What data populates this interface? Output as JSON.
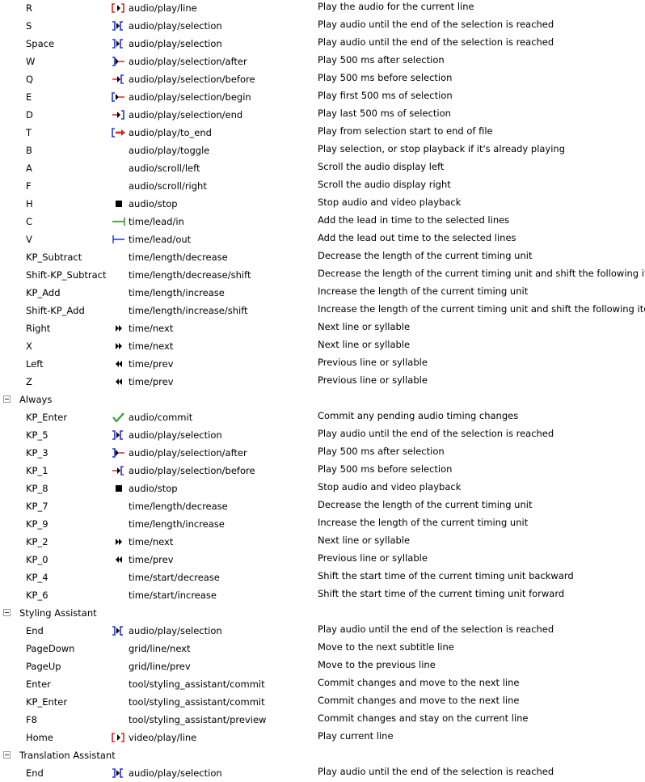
{
  "rows": [
    {
      "key": "R",
      "icon": "play-line",
      "command": "audio/play/line",
      "description": "Play the audio for the current line"
    },
    {
      "key": "S",
      "icon": "play-selection",
      "command": "audio/play/selection",
      "description": "Play audio until the end of the selection is reached"
    },
    {
      "key": "Space",
      "icon": "play-selection",
      "command": "audio/play/selection",
      "description": "Play audio until the end of the selection is reached"
    },
    {
      "key": "W",
      "icon": "play-after",
      "command": "audio/play/selection/after",
      "description": "Play 500 ms after selection"
    },
    {
      "key": "Q",
      "icon": "play-before",
      "command": "audio/play/selection/before",
      "description": "Play 500 ms before selection"
    },
    {
      "key": "E",
      "icon": "play-begin",
      "command": "audio/play/selection/begin",
      "description": "Play first 500 ms of selection"
    },
    {
      "key": "D",
      "icon": "play-end",
      "command": "audio/play/selection/end",
      "description": "Play last 500 ms of selection"
    },
    {
      "key": "T",
      "icon": "play-to-end",
      "command": "audio/play/to_end",
      "description": "Play from selection start to end of file"
    },
    {
      "key": "B",
      "icon": "",
      "command": "audio/play/toggle",
      "description": "Play selection, or stop playback if it's already playing"
    },
    {
      "key": "A",
      "icon": "",
      "command": "audio/scroll/left",
      "description": "Scroll the audio display left"
    },
    {
      "key": "F",
      "icon": "",
      "command": "audio/scroll/right",
      "description": "Scroll the audio display right"
    },
    {
      "key": "H",
      "icon": "stop",
      "command": "audio/stop",
      "description": "Stop audio and video playback"
    },
    {
      "key": "C",
      "icon": "lead-in",
      "command": "time/lead/in",
      "description": "Add the lead in time to the selected lines"
    },
    {
      "key": "V",
      "icon": "lead-out",
      "command": "time/lead/out",
      "description": "Add the lead out time to the selected lines"
    },
    {
      "key": "KP_Subtract",
      "icon": "",
      "command": "time/length/decrease",
      "description": "Decrease the length of the current timing unit"
    },
    {
      "key": "Shift-KP_Subtract",
      "icon": "",
      "command": "time/length/decrease/shift",
      "description": "Decrease the length of the current timing unit and shift the following items"
    },
    {
      "key": "KP_Add",
      "icon": "",
      "command": "time/length/increase",
      "description": "Increase the length of the current timing unit"
    },
    {
      "key": "Shift-KP_Add",
      "icon": "",
      "command": "time/length/increase/shift",
      "description": "Increase the length of the current timing unit and shift the following items"
    },
    {
      "key": "Right",
      "icon": "next",
      "command": "time/next",
      "description": "Next line or syllable"
    },
    {
      "key": "X",
      "icon": "next",
      "command": "time/next",
      "description": "Next line or syllable"
    },
    {
      "key": "Left",
      "icon": "prev",
      "command": "time/prev",
      "description": "Previous line or syllable"
    },
    {
      "key": "Z",
      "icon": "prev",
      "command": "time/prev",
      "description": "Previous line or syllable"
    },
    {
      "group": "Always"
    },
    {
      "key": "KP_Enter",
      "icon": "commit",
      "command": "audio/commit",
      "description": "Commit any pending audio timing changes"
    },
    {
      "key": "KP_5",
      "icon": "play-selection",
      "command": "audio/play/selection",
      "description": "Play audio until the end of the selection is reached"
    },
    {
      "key": "KP_3",
      "icon": "play-after",
      "command": "audio/play/selection/after",
      "description": "Play 500 ms after selection"
    },
    {
      "key": "KP_1",
      "icon": "play-before",
      "command": "audio/play/selection/before",
      "description": "Play 500 ms before selection"
    },
    {
      "key": "KP_8",
      "icon": "stop",
      "command": "audio/stop",
      "description": "Stop audio and video playback"
    },
    {
      "key": "KP_7",
      "icon": "",
      "command": "time/length/decrease",
      "description": "Decrease the length of the current timing unit"
    },
    {
      "key": "KP_9",
      "icon": "",
      "command": "time/length/increase",
      "description": "Increase the length of the current timing unit"
    },
    {
      "key": "KP_2",
      "icon": "next",
      "command": "time/next",
      "description": "Next line or syllable"
    },
    {
      "key": "KP_0",
      "icon": "prev",
      "command": "time/prev",
      "description": "Previous line or syllable"
    },
    {
      "key": "KP_4",
      "icon": "",
      "command": "time/start/decrease",
      "description": "Shift the start time of the current timing unit backward"
    },
    {
      "key": "KP_6",
      "icon": "",
      "command": "time/start/increase",
      "description": "Shift the start time of the current timing unit forward"
    },
    {
      "group": "Styling Assistant"
    },
    {
      "key": "End",
      "icon": "play-selection",
      "command": "audio/play/selection",
      "description": "Play audio until the end of the selection is reached"
    },
    {
      "key": "PageDown",
      "icon": "",
      "command": "grid/line/next",
      "description": "Move to the next subtitle line"
    },
    {
      "key": "PageUp",
      "icon": "",
      "command": "grid/line/prev",
      "description": "Move to the previous line"
    },
    {
      "key": "Enter",
      "icon": "",
      "command": "tool/styling_assistant/commit",
      "description": "Commit changes and move to the next line"
    },
    {
      "key": "KP_Enter",
      "icon": "",
      "command": "tool/styling_assistant/commit",
      "description": "Commit changes and move to the next line"
    },
    {
      "key": "F8",
      "icon": "",
      "command": "tool/styling_assistant/preview",
      "description": "Commit changes and stay on the current line"
    },
    {
      "key": "Home",
      "icon": "play-line",
      "command": "video/play/line",
      "description": "Play current line"
    },
    {
      "group": "Translation Assistant"
    },
    {
      "key": "End",
      "icon": "play-selection",
      "command": "audio/play/selection",
      "description": "Play audio until the end of the selection is reached"
    }
  ],
  "colors": {
    "red": "#e02020",
    "blue": "#2030e0",
    "green": "#30a030"
  }
}
